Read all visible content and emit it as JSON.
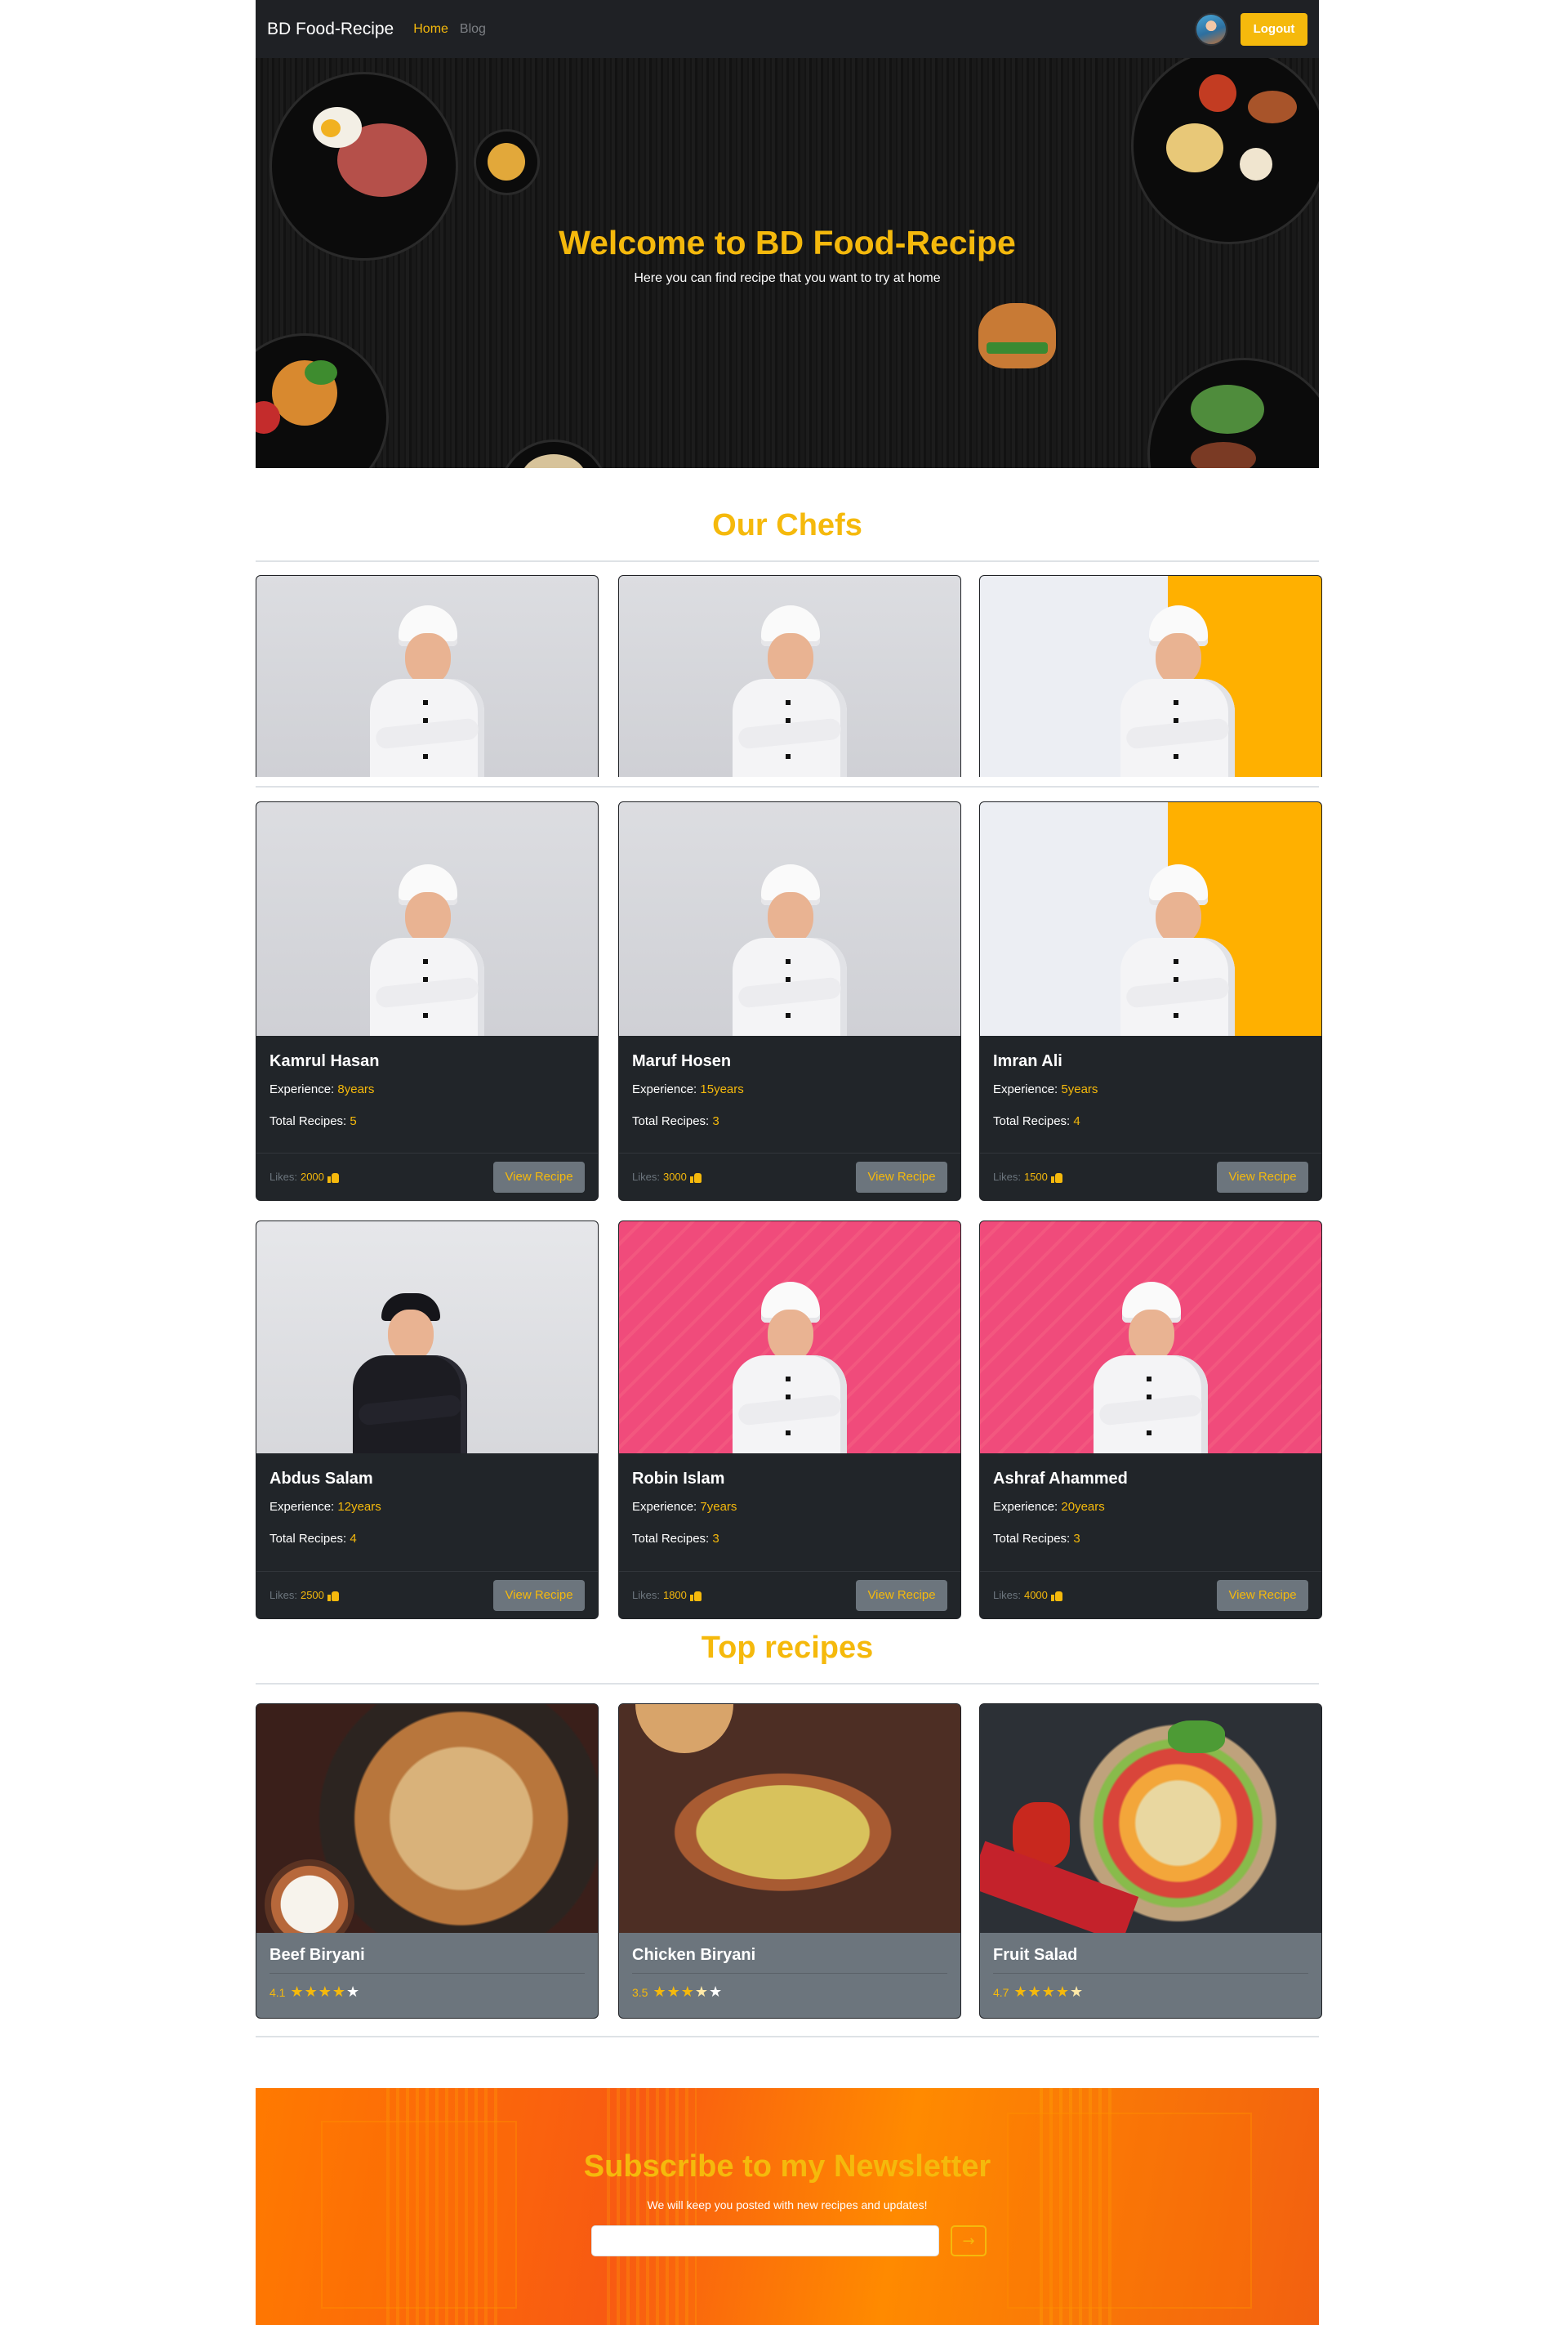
{
  "navbar": {
    "brand": "BD Food-Recipe",
    "links": [
      {
        "label": "Home",
        "active": true
      },
      {
        "label": "Blog",
        "active": false
      }
    ],
    "logout_label": "Logout"
  },
  "hero": {
    "title": "Welcome to BD Food-Recipe",
    "subtitle": "Here you can find recipe that you want to try at home"
  },
  "chefs_section": {
    "title": "Our Chefs",
    "chefs": [
      {
        "name": "Kamrul Hasan",
        "experience_label": "Experience: ",
        "experience": "8years",
        "recipes_label": "Total Recipes: ",
        "recipes": "5",
        "likes_label": "Likes: ",
        "likes": "2000",
        "button": "View Recipe"
      },
      {
        "name": "Maruf Hosen",
        "experience_label": "Experience: ",
        "experience": "15years",
        "recipes_label": "Total Recipes: ",
        "recipes": "3",
        "likes_label": "Likes: ",
        "likes": "3000",
        "button": "View Recipe"
      },
      {
        "name": "Imran Ali",
        "experience_label": "Experience: ",
        "experience": "5years",
        "recipes_label": "Total Recipes: ",
        "recipes": "4",
        "likes_label": "Likes: ",
        "likes": "1500",
        "button": "View Recipe"
      },
      {
        "name": "Abdus Salam",
        "experience_label": "Experience: ",
        "experience": "12years",
        "recipes_label": "Total Recipes: ",
        "recipes": "4",
        "likes_label": "Likes: ",
        "likes": "2500",
        "button": "View Recipe"
      },
      {
        "name": "Robin Islam",
        "experience_label": "Experience: ",
        "experience": "7years",
        "recipes_label": "Total Recipes: ",
        "recipes": "3",
        "likes_label": "Likes: ",
        "likes": "1800",
        "button": "View Recipe"
      },
      {
        "name": "Ashraf Ahammed",
        "experience_label": "Experience: ",
        "experience": "20years",
        "recipes_label": "Total Recipes: ",
        "recipes": "3",
        "likes_label": "Likes: ",
        "likes": "4000",
        "button": "View Recipe"
      }
    ]
  },
  "recipes_section": {
    "title": "Top recipes",
    "recipes": [
      {
        "name": "Beef Biryani",
        "rating": "4.1"
      },
      {
        "name": "Chicken Biryani",
        "rating": "3.5"
      },
      {
        "name": "Fruit Salad",
        "rating": "4.7"
      }
    ]
  },
  "newsletter": {
    "title": "Subscribe to my Newsletter",
    "subtitle": "We will keep you posted with new recipes and updates!",
    "input_value": "",
    "submit_icon": "arrow-right-icon"
  },
  "colors": {
    "accent": "#f5b90c",
    "dark": "#212529",
    "muted": "#6c757d"
  }
}
